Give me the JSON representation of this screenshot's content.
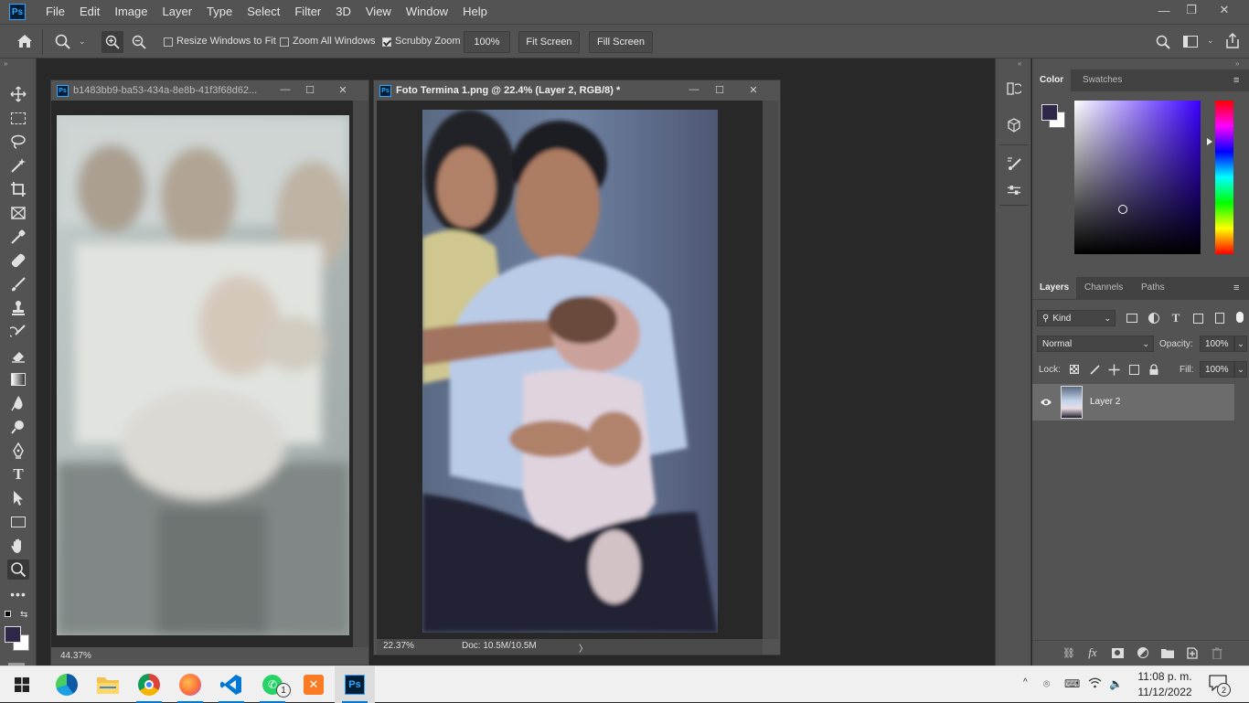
{
  "app": {
    "logo": "Ps",
    "accent": "#31a8ff"
  },
  "menu": [
    "File",
    "Edit",
    "Image",
    "Layer",
    "Type",
    "Select",
    "Filter",
    "3D",
    "View",
    "Window",
    "Help"
  ],
  "window_controls": {
    "minimize": "—",
    "restore": "❐",
    "close": "✕"
  },
  "options": {
    "resize_windows_label": "Resize Windows to Fit",
    "resize_windows_checked": false,
    "zoom_all_label": "Zoom All Windows",
    "zoom_all_checked": false,
    "scrubby_label": "Scrubby Zoom",
    "scrubby_checked": true,
    "zoom_value": "100%",
    "fit_screen": "Fit Screen",
    "fill_screen": "Fill Screen"
  },
  "doc1": {
    "title": "b1483bb9-ba53-434a-8e8b-41f3f68d62...",
    "zoom": "44.37%"
  },
  "doc2": {
    "title": "Foto Termina 1.png @ 22.4% (Layer 2, RGB/8) *",
    "zoom": "22.37%",
    "doc_info": "Doc: 10.5M/10.5M",
    "arrow": "〉"
  },
  "color_panel": {
    "tabs": [
      "Color",
      "Swatches"
    ],
    "fg_color": "#2e2748",
    "bg_color": "#ffffff",
    "hue_color": "#3a00ff"
  },
  "layers_panel": {
    "tabs": [
      "Layers",
      "Channels",
      "Paths"
    ],
    "kind": "Kind",
    "blend_mode": "Normal",
    "opacity_label": "Opacity:",
    "opacity": "100%",
    "lock_label": "Lock:",
    "fill_label": "Fill:",
    "fill": "100%",
    "layers": [
      {
        "name": "Layer 2",
        "visible": true
      }
    ]
  },
  "taskbar": {
    "time": "11:08 p. m.",
    "date": "11/12/2022",
    "whatsapp_badge": "1",
    "notif_badge": "2",
    "ps_label": "Ps"
  }
}
